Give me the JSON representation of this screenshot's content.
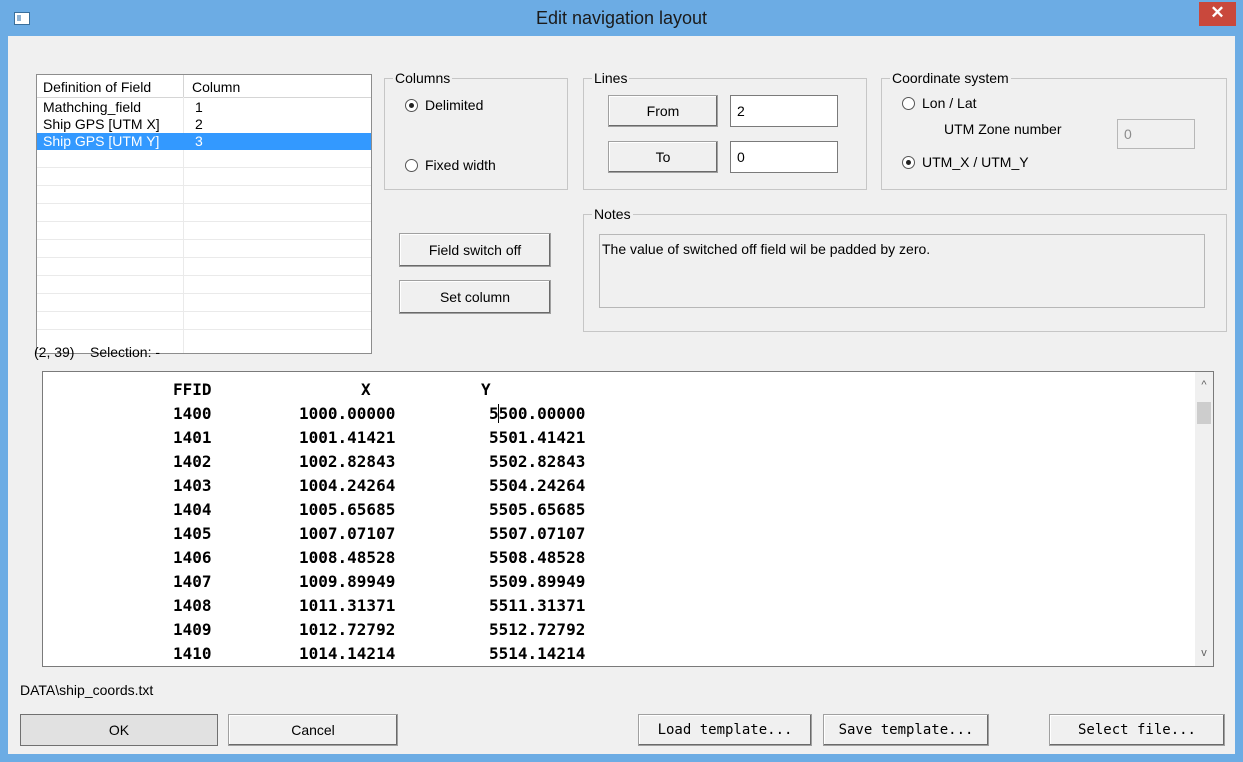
{
  "window": {
    "title": "Edit navigation layout",
    "close_glyph": "✕"
  },
  "field_list": {
    "headers": [
      "Definition of Field",
      "Column"
    ],
    "rows": [
      {
        "field": "Mathching_field",
        "column": "1",
        "selected": false
      },
      {
        "field": "Ship GPS [UTM X]",
        "column": "2",
        "selected": false
      },
      {
        "field": "Ship GPS [UTM Y]",
        "column": "3",
        "selected": true
      }
    ]
  },
  "columns_group": {
    "label": "Columns",
    "options": [
      {
        "label": "Delimited",
        "checked": true
      },
      {
        "label": "Fixed width",
        "checked": false
      }
    ]
  },
  "lines_group": {
    "label": "Lines",
    "from_label": "From",
    "from_value": "2",
    "to_label": "To",
    "to_value": "0"
  },
  "coord_group": {
    "label": "Coordinate system",
    "lonlat_label": "Lon / Lat",
    "lonlat_checked": false,
    "utm_zone_label": "UTM Zone number",
    "utm_zone_value": "0",
    "utm_label": "UTM_X / UTM_Y",
    "utm_checked": true
  },
  "buttons": {
    "field_switch_off": "Field switch off",
    "set_column": "Set column",
    "ok": "OK",
    "cancel": "Cancel",
    "load_template": "Load template...",
    "save_template": "Save template...",
    "select_file": "Select file..."
  },
  "notes": {
    "label": "Notes",
    "text": "The value of switched off field wil be padded by zero."
  },
  "status": {
    "position": "(2, 39)",
    "selection": "Selection: -"
  },
  "data_view": {
    "header": [
      "FFID",
      "X",
      "Y"
    ],
    "rows": [
      [
        "1400",
        "1000.00000",
        "5500.00000"
      ],
      [
        "1401",
        "1001.41421",
        "5501.41421"
      ],
      [
        "1402",
        "1002.82843",
        "5502.82843"
      ],
      [
        "1403",
        "1004.24264",
        "5504.24264"
      ],
      [
        "1404",
        "1005.65685",
        "5505.65685"
      ],
      [
        "1405",
        "1007.07107",
        "5507.07107"
      ],
      [
        "1406",
        "1008.48528",
        "5508.48528"
      ],
      [
        "1407",
        "1009.89949",
        "5509.89949"
      ],
      [
        "1408",
        "1011.31371",
        "5511.31371"
      ],
      [
        "1409",
        "1012.72792",
        "5512.72792"
      ],
      [
        "1410",
        "1014.14214",
        "5514.14214"
      ]
    ],
    "scroll_up_glyph": "^",
    "scroll_down_glyph": "v"
  },
  "file_path": "DATA\\ship_coords.txt",
  "colors": {
    "titlebar": "#6cace4",
    "close_button": "#c9483c",
    "selection": "#3399ff",
    "dialog_bg": "#f0f0f0"
  }
}
